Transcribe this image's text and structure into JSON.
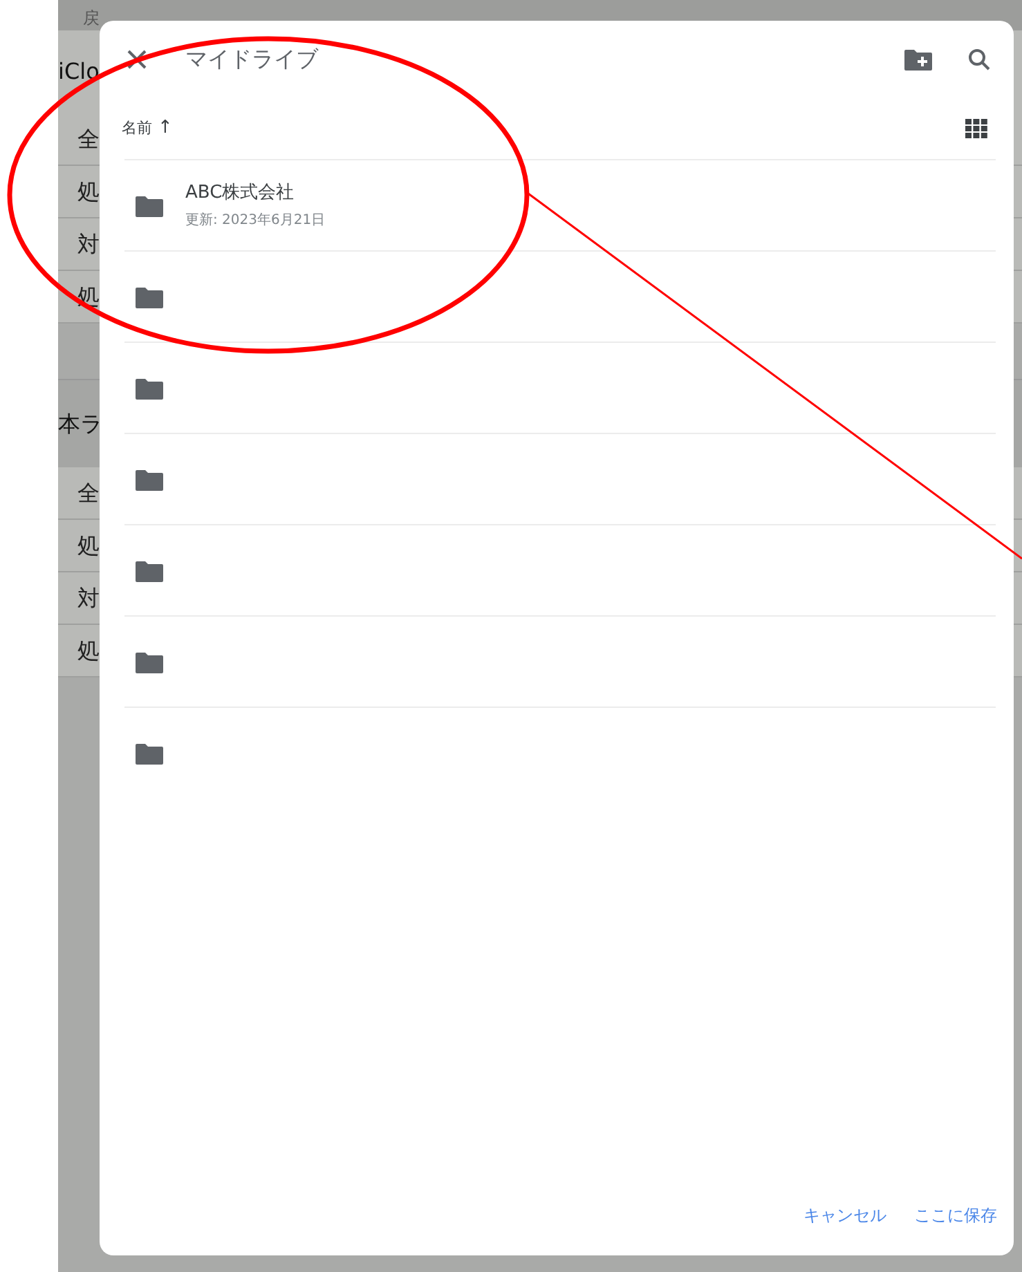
{
  "background": {
    "top_label": "戻",
    "sections": [
      {
        "heading": "iClo",
        "items": [
          "全",
          "処",
          "対",
          "処"
        ]
      },
      {
        "heading": "本ラ",
        "items": [
          "全",
          "処",
          "対",
          "処"
        ]
      }
    ]
  },
  "dialog": {
    "title": "マイドライブ",
    "sort": {
      "label": "名前",
      "arrow": "↑"
    },
    "folders": [
      {
        "kind": "folder",
        "name": "ABC株式会社",
        "updated": "更新: 2023年6月21日"
      },
      {
        "kind": "folder"
      },
      {
        "kind": "folder"
      },
      {
        "kind": "folder"
      },
      {
        "kind": "folder"
      },
      {
        "kind": "folder"
      },
      {
        "kind": "folder"
      }
    ],
    "buttons": [
      "キャンセル",
      "ここに保存"
    ]
  }
}
